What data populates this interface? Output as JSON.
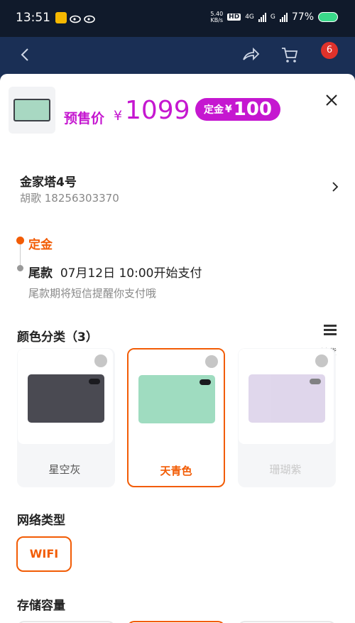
{
  "status": {
    "time": "13:51",
    "net_speed": "5.40",
    "net_unit": "KB/s",
    "hd": "HD",
    "sig1": "4G",
    "sig2": "G",
    "battery": "77%"
  },
  "background": {
    "cart_badge": "6"
  },
  "product": {
    "presale_label": "预售价",
    "currency": "¥",
    "price": "1099",
    "deposit_label": "定金",
    "deposit_currency": "¥",
    "deposit_value": "100"
  },
  "address": {
    "name": "金家塔4号",
    "contact": "胡歌 18256303370"
  },
  "payment": {
    "step1": "定金",
    "step2_label": "尾款",
    "step2_time": "07月12日 10:00开始支付",
    "note": "尾款期将短信提醒你支付哦"
  },
  "colors": {
    "title": "颜色分类（3）",
    "list_label": "缺货",
    "items": [
      {
        "label": "星空灰",
        "tablet_color": "#4a4a52"
      },
      {
        "label": "天青色",
        "tablet_color": "#9fdcc0"
      },
      {
        "label": "珊瑚紫",
        "tablet_color": "#c6b6dc"
      }
    ]
  },
  "network": {
    "title": "网络类型",
    "option": "WIFI"
  },
  "storage": {
    "title": "存储容量"
  },
  "accent_color": "#f25c05",
  "price_color": "#c517d0"
}
